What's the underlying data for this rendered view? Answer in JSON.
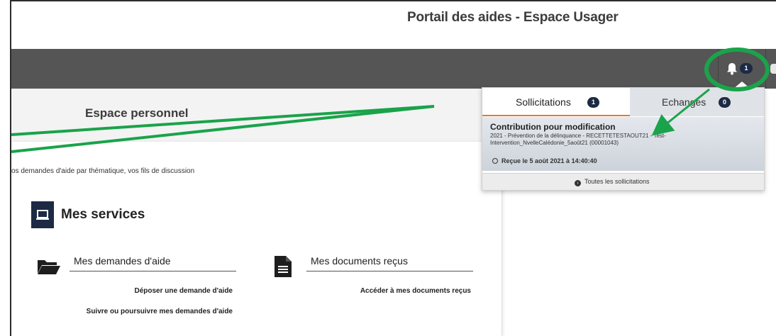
{
  "header": {
    "portal_title": "Portail des aides - Espace Usager",
    "bell_count": "1"
  },
  "left": {
    "espace_title": "Espace personnel",
    "intro": "os demandes d'aide par thématique, vos fils de discussion",
    "services_title": "Mes services"
  },
  "services": {
    "demandes": {
      "title": "Mes demandes d'aide",
      "link_deposer": "Déposer une demande d'aide",
      "link_suivre": "Suivre ou poursuivre mes demandes d'aide"
    },
    "documents": {
      "title": "Mes documents reçus",
      "link_acceder": "Accéder à mes documents reçus"
    }
  },
  "popup": {
    "tab_sollicitations": "Sollicitations",
    "tab_sollicitations_count": "1",
    "tab_echanges": "Echanges",
    "tab_echanges_count": "0",
    "notification": {
      "title": "Contribution pour modification",
      "description": "2021 - Prévention de la délinquance - RECETTETESTAOUT21 - Test-Intervention_NvelleCalédonie_5août21 (00001043)",
      "received_prefix": "Reçue le ",
      "received_date": "5 août 2021 à 14:40:40"
    },
    "all_link": "Toutes les sollicitations"
  },
  "colors": {
    "topbar": "#555555",
    "badge": "#1c2a44",
    "tab_accent": "#e47a2e",
    "annotation": "#1aa34a"
  },
  "icons": [
    "bell-icon",
    "user-icon",
    "laptop-icon",
    "folder-open-icon",
    "file-text-icon",
    "clock-icon",
    "arrow-circle-icon"
  ]
}
